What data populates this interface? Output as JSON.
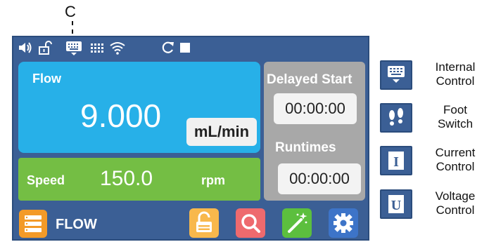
{
  "callout": {
    "letter": "C"
  },
  "statusbar": {
    "icons": [
      "speaker-icon",
      "unlock-icon",
      "keyboard-icon",
      "grid-icon",
      "wifi-icon",
      "refresh-icon",
      "stop-icon"
    ]
  },
  "flow": {
    "title": "Flow",
    "value": "9.000",
    "unit": "mL/min"
  },
  "speed": {
    "label": "Speed",
    "value": "150.0",
    "unit": "rpm"
  },
  "delayed_start": {
    "label": "Delayed Start",
    "time": "00:00:00"
  },
  "runtimes": {
    "label": "Runtimes",
    "time": "00:00:00"
  },
  "bottombar": {
    "menu_label": "FLOW",
    "buttons": [
      "lock-button",
      "search-button",
      "wand-button",
      "settings-button"
    ]
  },
  "legend": [
    {
      "icon": "keyboard-icon",
      "line1": "Internal",
      "line2": "Control"
    },
    {
      "icon": "footprints-icon",
      "line1": "Foot",
      "line2": "Switch"
    },
    {
      "icon": "letter-i-icon",
      "line1": "Current",
      "line2": "Control"
    },
    {
      "icon": "letter-u-icon",
      "line1": "Voltage",
      "line2": "Control"
    }
  ],
  "colors": {
    "screen_bg": "#3b5f95",
    "flow_panel": "#27b0e8",
    "speed_panel": "#74be44",
    "time_panel": "#a8a8a8",
    "menu_button": "#f39a28",
    "lock_button": "#f8b84c",
    "search_button": "#ee6a6e",
    "wand_button": "#5cbf3e",
    "settings_button": "#3d74c8"
  }
}
